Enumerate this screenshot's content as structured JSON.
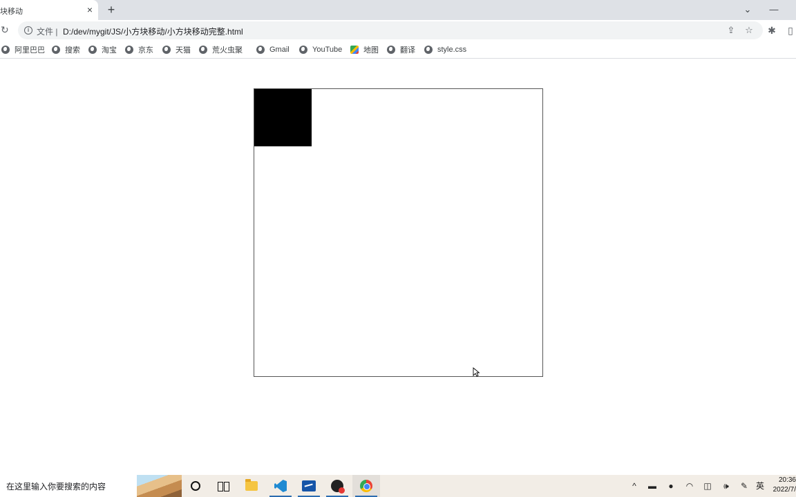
{
  "tab": {
    "title": "块移动",
    "close_icon": "×"
  },
  "newtab_icon": "+",
  "window": {
    "dropdown_icon": "⌄",
    "minimize_icon": "—"
  },
  "toolbar": {
    "reload_icon": "↻",
    "scheme_label": "文件 |",
    "url": "D:/dev/mygit/JS/小方块移动/小方块移动完整.html",
    "share_icon": "⇪",
    "star_icon": "☆",
    "extensions_icon": "✱",
    "sidepanel_icon": "▯"
  },
  "bookmarks": [
    {
      "label": "阿里巴巴",
      "icon": "globe-icon"
    },
    {
      "label": "搜索",
      "icon": "globe-icon"
    },
    {
      "label": "淘宝",
      "icon": "globe-icon"
    },
    {
      "label": "京东",
      "icon": "globe-icon"
    },
    {
      "label": "天猫",
      "icon": "globe-icon"
    },
    {
      "label": "荒火虫聚",
      "icon": "globe-icon"
    },
    {
      "label": "Gmail",
      "icon": "globe-icon"
    },
    {
      "label": "YouTube",
      "icon": "globe-icon"
    },
    {
      "label": "地图",
      "icon": "map-icon"
    },
    {
      "label": "翻译",
      "icon": "globe-icon"
    },
    {
      "label": "style.css",
      "icon": "globe-icon"
    }
  ],
  "taskbar": {
    "search_placeholder": "在这里输入你要搜索的内容",
    "tray": {
      "chevron": "^",
      "battery": "▬",
      "mic": "●",
      "wifi": "◠",
      "shield": "◫",
      "volume": "🕪",
      "pen": "✎",
      "ime": "英"
    },
    "time": "20:36",
    "date": "2022/7/"
  }
}
